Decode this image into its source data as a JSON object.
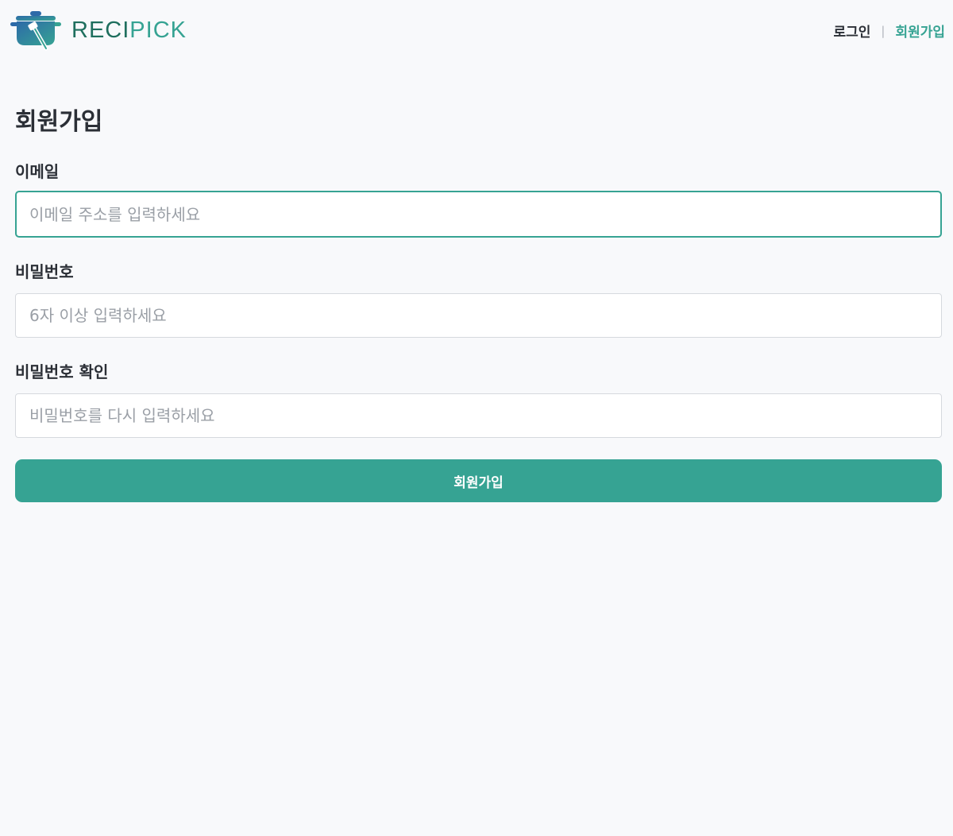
{
  "brand": {
    "logo_text_part1": "RECI",
    "logo_text_part2": "PICK",
    "logo_icon": "cooking-pot-icon",
    "primary_color": "#36a393",
    "dark_brand_color": "#1f6f5e"
  },
  "nav": {
    "login_label": "로그인",
    "separator": "|",
    "signup_label": "회원가입"
  },
  "form": {
    "title": "회원가입",
    "fields": [
      {
        "label": "이메일",
        "value": "",
        "placeholder": "이메일 주소를 입력하세요",
        "focused": true
      },
      {
        "label": "비밀번호",
        "value": "",
        "placeholder": "6자 이상 입력하세요",
        "focused": false
      },
      {
        "label": "비밀번호 확인",
        "value": "",
        "placeholder": "비밀번호를 다시 입력하세요",
        "focused": false
      }
    ],
    "submit_label": "회원가입"
  }
}
